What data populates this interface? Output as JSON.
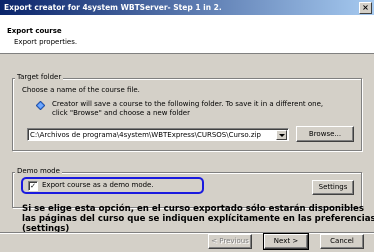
{
  "window": {
    "title": "Export creator for 4system WBTServer- Step 1 in 2.",
    "close_glyph": "×"
  },
  "header": {
    "title": "Export course",
    "subtitle": "Export properties."
  },
  "target_folder": {
    "group_label": "Target folder",
    "instruction": "Choose a name of the course file.",
    "info_line1": "Creator will save a course to the following folder. To save it in a different one,",
    "info_line2": "click \"Browse\" and choose a new folder",
    "path_value": "C:\\Archivos de programa\\4system\\WBTExpress\\CURSOS\\Curso.zip",
    "browse_label": "Browse..."
  },
  "demo_mode": {
    "group_label": "Demo mode",
    "checkbox_label": "Export course as a demo mode.",
    "checkbox_checked": true,
    "checkbox_glyph": "✓",
    "settings_label": "Settings"
  },
  "annotation": {
    "line1": "Si se elige esta opción, en el curso exportado sólo estarán disponibles",
    "line2": "las páginas del curso que se indiquen explícitamente en las preferencias",
    "line3": "(settings)"
  },
  "footer": {
    "previous_label": "< Previous",
    "next_label": "Next >",
    "cancel_label": "Cancel"
  },
  "colors": {
    "title_bar_start": "#0a246a",
    "title_bar_end": "#a6caf0",
    "highlight": "#1a1adf",
    "dialog_bg": "#d4d0c8"
  },
  "icons": {
    "info": "info-diamond-icon",
    "close": "close-icon",
    "dropdown": "chevron-down-icon"
  }
}
